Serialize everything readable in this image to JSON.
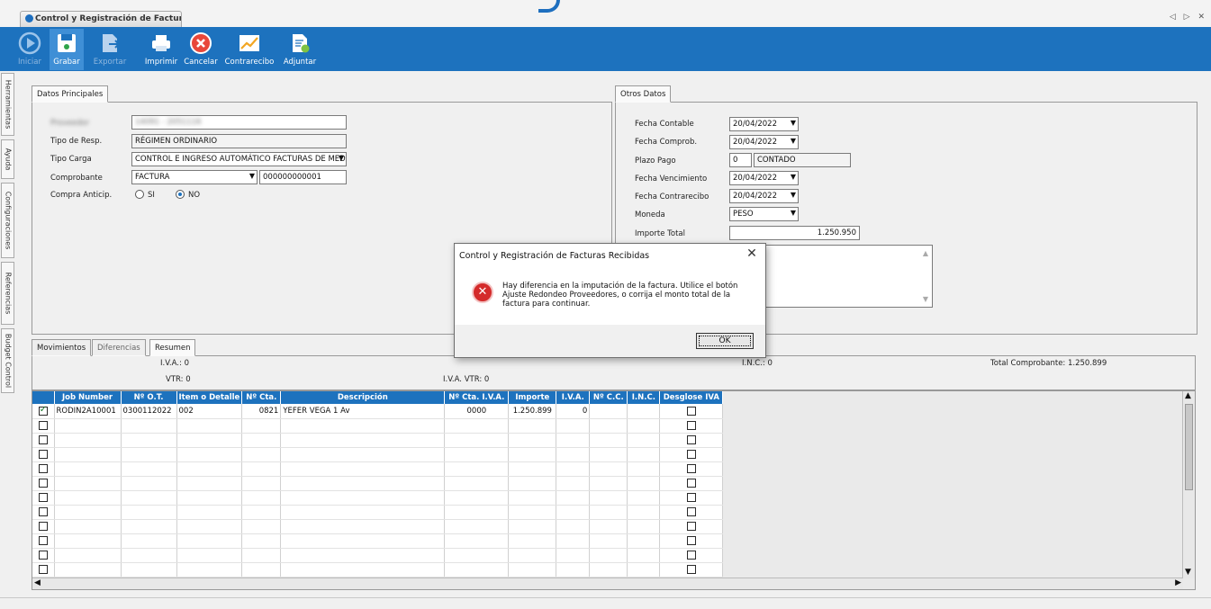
{
  "window": {
    "tab_title": "Control y Registración de Factura...",
    "controls": "◁ ▷ ✕"
  },
  "toolbar": {
    "buttons": [
      {
        "label": "Iniciar",
        "icon": "play-icon",
        "enabled": false
      },
      {
        "label": "Grabar",
        "icon": "save-icon",
        "enabled": true,
        "active": true
      },
      {
        "label": "Exportar",
        "icon": "export-icon",
        "enabled": false
      },
      {
        "label": "Imprimir",
        "icon": "printer-icon",
        "enabled": true
      },
      {
        "label": "Cancelar",
        "icon": "cancel-icon",
        "enabled": true
      },
      {
        "label": "Contrarecibo",
        "icon": "chart-icon",
        "enabled": true
      },
      {
        "label": "Adjuntar",
        "icon": "attach-icon",
        "enabled": true
      }
    ]
  },
  "sidebar": {
    "tabs": [
      "Herramientas",
      "Ayuda",
      "Configuraciones",
      "Referencias",
      "Budget Control"
    ]
  },
  "datos_principales": {
    "tab": "Datos Principales",
    "proveedor_label": "Proveedor",
    "proveedor_value": "14091 - 2051116",
    "tipo_resp_label": "Tipo de Resp.",
    "tipo_resp_value": "RÉGIMEN ORDINARIO",
    "tipo_carga_label": "Tipo Carga",
    "tipo_carga_value": "CONTROL E INGRESO AUTOMÁTICO FACTURAS DE MED",
    "comprobante_label": "Comprobante",
    "comprobante_value": "FACTURA",
    "comprobante_numero": "000000000001",
    "compra_anticip_label": "Compra Anticip.",
    "opcion_si": "SI",
    "opcion_no": "NO",
    "selected": "NO"
  },
  "otros_datos": {
    "tab": "Otros Datos",
    "fecha_contable_label": "Fecha Contable",
    "fecha_contable": "20/04/2022",
    "fecha_comprob_label": "Fecha Comprob.",
    "fecha_comprob": "20/04/2022",
    "plazo_pago_label": "Plazo Pago",
    "plazo_pago_dias": "0",
    "plazo_pago_desc": "CONTADO",
    "fecha_vencimiento_label": "Fecha Vencimiento",
    "fecha_vencimiento": "20/04/2022",
    "fecha_contrarecibo_label": "Fecha Contrarecibo",
    "fecha_contrarecibo": "20/04/2022",
    "moneda_label": "Moneda",
    "moneda": "PESO",
    "importe_total_label": "Importe Total",
    "importe_total": "1.250.950"
  },
  "bottom_tabs": {
    "tabs": [
      "Movimientos",
      "Diferencias",
      "Resumen"
    ],
    "active": "Resumen"
  },
  "resumen": {
    "iva": "I.V.A.: 0",
    "vtr": "VTR: 0",
    "iva_vtr": "I.V.A. VTR: 0",
    "inc": "I.N.C.: 0",
    "total_comprobante": "Total Comprobante: 1.250.899"
  },
  "grid": {
    "columns": [
      "Job Number",
      "Nº O.T.",
      "Item o Detalle",
      "Nº Cta.",
      "Descripción",
      "Nº Cta. I.V.A.",
      "Importe",
      "I.V.A.",
      "Nº C.C.",
      "I.N.C.",
      "Desglose IVA"
    ],
    "rows": [
      {
        "checked": true,
        "job": "RODIN2A10001",
        "ot": "0300112022",
        "item": "002",
        "cta": "0821",
        "desc": "YEFER VEGA 1 Av",
        "cta_iva": "0000",
        "importe": "1.250.899",
        "iva": "0",
        "cc": "",
        "inc": ""
      },
      {
        "checked": false
      },
      {
        "checked": false
      },
      {
        "checked": false
      },
      {
        "checked": false
      },
      {
        "checked": false
      },
      {
        "checked": false
      },
      {
        "checked": false
      },
      {
        "checked": false
      },
      {
        "checked": false
      },
      {
        "checked": false
      },
      {
        "checked": false
      }
    ]
  },
  "dialog": {
    "title": "Control y Registración de Facturas Recibidas",
    "close": "✕",
    "message": "Hay diferencia en la imputación de la factura. Utilice el botón Ajuste Redondeo Proveedores,  o corrija el monto total de la factura para continuar.",
    "ok_label": "OK",
    "error_glyph": "✕"
  }
}
